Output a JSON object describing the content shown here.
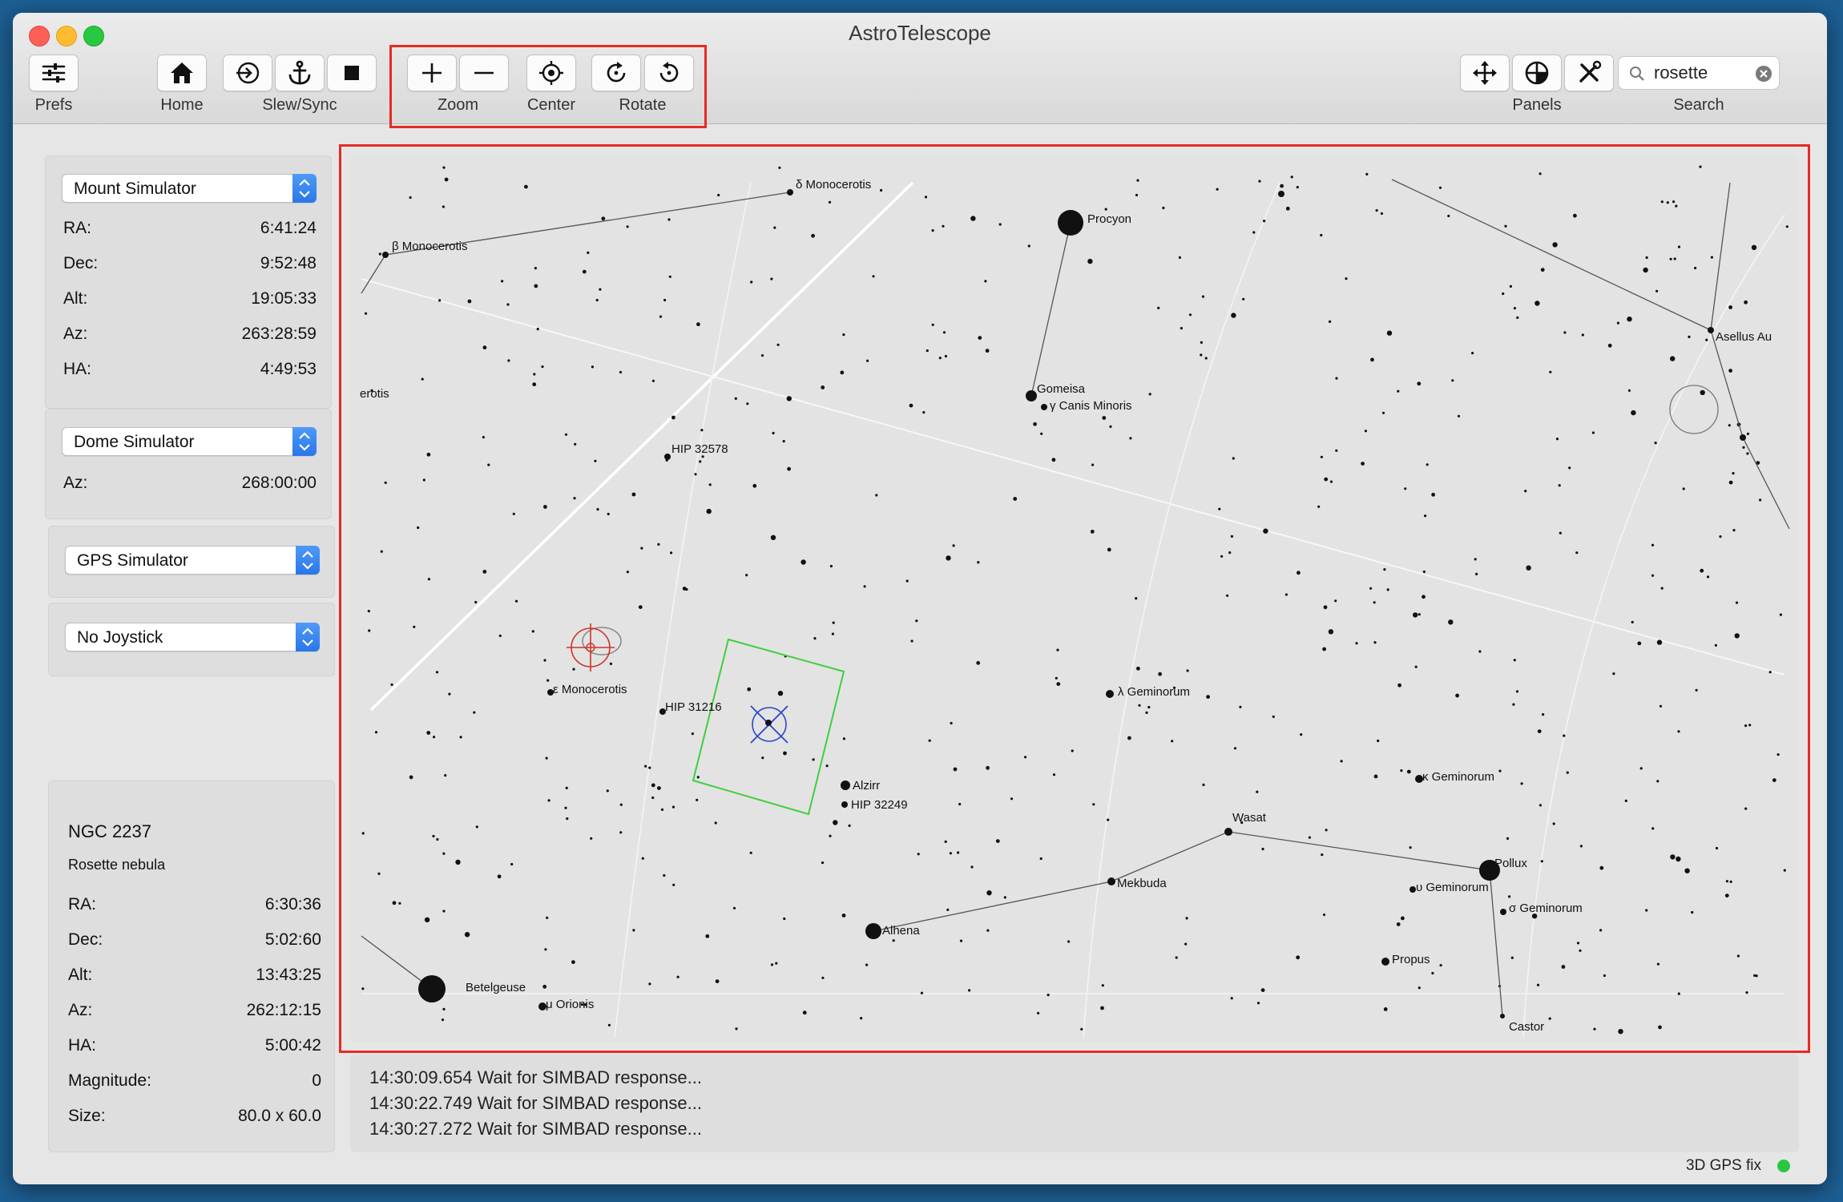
{
  "window": {
    "title": "AstroTelescope"
  },
  "toolbar": {
    "prefs_label": "Prefs",
    "home_label": "Home",
    "slew_sync_label": "Slew/Sync",
    "zoom_label": "Zoom",
    "center_label": "Center",
    "rotate_label": "Rotate",
    "panels_label": "Panels",
    "search_label": "Search",
    "search_value": "rosette"
  },
  "mount": {
    "selected": "Mount Simulator",
    "rows": [
      {
        "key": "RA:",
        "value": "6:41:24"
      },
      {
        "key": "Dec:",
        "value": "9:52:48"
      },
      {
        "key": "Alt:",
        "value": "19:05:33"
      },
      {
        "key": "Az:",
        "value": "263:28:59"
      },
      {
        "key": "HA:",
        "value": "4:49:53"
      }
    ]
  },
  "dome": {
    "selected": "Dome Simulator",
    "az_key": "Az:",
    "az_value": "268:00:00"
  },
  "gps": {
    "selected": "GPS Simulator"
  },
  "joystick": {
    "selected": "No Joystick"
  },
  "object": {
    "name": "NGC 2237",
    "desc": "Rosette nebula",
    "rows": [
      {
        "key": "RA:",
        "value": "6:30:36"
      },
      {
        "key": "Dec:",
        "value": "5:02:60"
      },
      {
        "key": "Alt:",
        "value": "13:43:25"
      },
      {
        "key": "Az:",
        "value": "262:12:15"
      },
      {
        "key": "HA:",
        "value": "5:00:42"
      },
      {
        "key": "Magnitude:",
        "value": "0"
      },
      {
        "key": "Size:",
        "value": "80.0 x 60.0"
      }
    ]
  },
  "sky": {
    "labels": {
      "delta_mon": "δ Monocerotis",
      "beta_mon": "β Monocerotis",
      "rotis": "erotis",
      "procyon": "Procyon",
      "gomeisa": "Gomeisa",
      "gamma_cmi": "γ Canis Minoris",
      "asellus": "Asellus Au",
      "hip32578": "HIP 32578",
      "eps_mon": "ε Monocerotis",
      "hip31216": "HIP 31216",
      "lambda_gem": "λ Geminorum",
      "alzirr": "Alzirr",
      "hip32249": "HIP 32249",
      "kappa_gem": "κ Geminorum",
      "wasat": "Wasat",
      "mekbuda": "Mekbuda",
      "pollux": "Pollux",
      "upsilon_gem": "υ Geminorum",
      "sigma_gem": "σ Geminorum",
      "alhena": "Alhena",
      "propus": "Propus",
      "betelgeuse": "Betelgeuse",
      "mu_ori": "μ Orionis",
      "castor": "Castor"
    }
  },
  "log": [
    "14:30:09.654 Wait for SIMBAD response...",
    "14:30:22.749 Wait for SIMBAD response...",
    "14:30:27.272 Wait for SIMBAD response..."
  ],
  "status": {
    "text": "3D GPS fix",
    "dot_color": "#27c840"
  },
  "colors": {
    "highlight": "#e52b23",
    "fov": "#3fcf3f",
    "target": "#2a47c9",
    "mount_marker": "#d0322a"
  },
  "icons": [
    "sliders-icon",
    "home-icon",
    "slew-icon",
    "anchor-icon",
    "stop-icon",
    "zoom-in-icon",
    "zoom-out-icon",
    "crosshair-icon",
    "rotate-cw-icon",
    "rotate-ccw-icon",
    "move-icon",
    "globe-grid-icon",
    "tools-icon",
    "search-icon",
    "clear-icon",
    "popup-arrows-icon"
  ]
}
